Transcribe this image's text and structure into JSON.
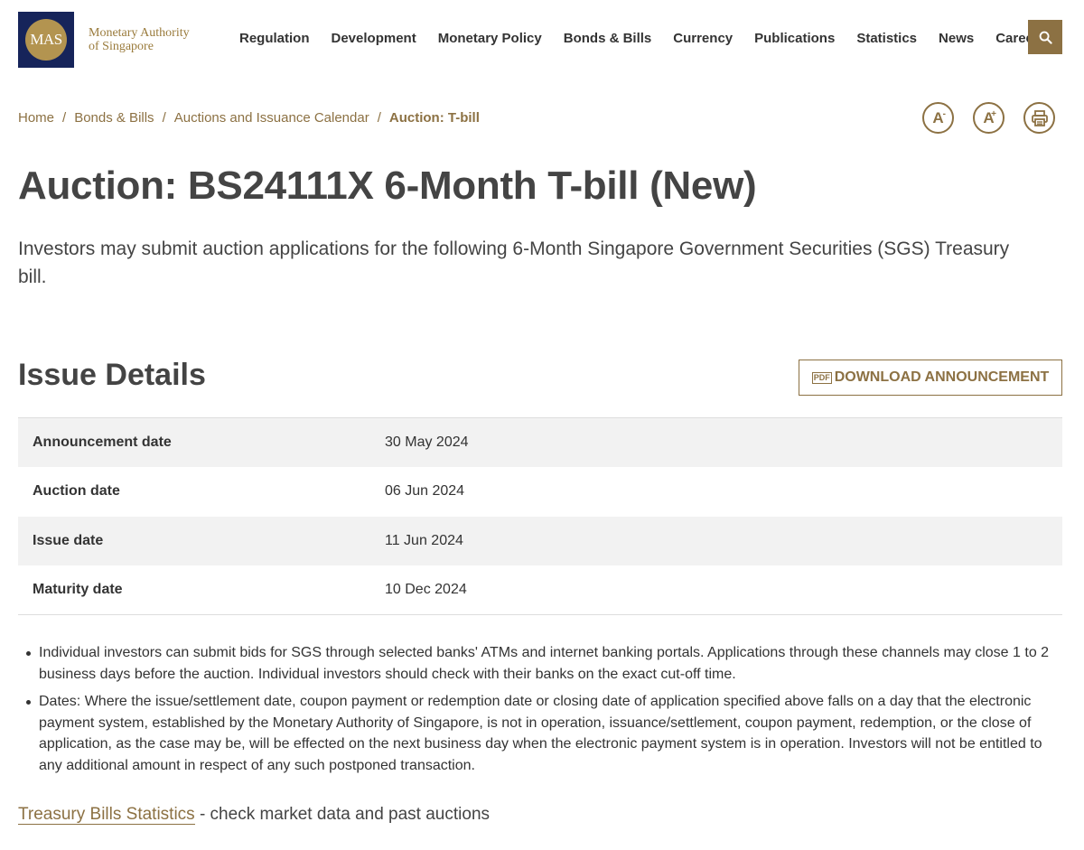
{
  "header": {
    "logo_abbr": "MAS",
    "logo_line1": "Monetary Authority",
    "logo_line2": "of Singapore",
    "nav": [
      {
        "label": "Regulation"
      },
      {
        "label": "Development"
      },
      {
        "label": "Monetary Policy"
      },
      {
        "label": "Bonds & Bills"
      },
      {
        "label": "Currency"
      },
      {
        "label": "Publications"
      },
      {
        "label": "Statistics"
      },
      {
        "label": "News"
      },
      {
        "label": "Careers"
      }
    ],
    "search_icon": "search-icon"
  },
  "breadcrumb": {
    "items": [
      {
        "label": "Home"
      },
      {
        "label": "Bonds & Bills"
      },
      {
        "label": "Auctions and Issuance Calendar"
      }
    ],
    "separator": "/",
    "current": "Auction: T-bill"
  },
  "tools": {
    "decrease_font": "A",
    "decrease_sup": "-",
    "increase_font": "A",
    "increase_sup": "+",
    "print_icon": "print-icon"
  },
  "page": {
    "title": "Auction: BS24111X 6-Month T-bill (New)",
    "intro": "Investors may submit auction applications for the following 6-Month Singapore Government Securities (SGS) Treasury bill."
  },
  "issue_details": {
    "title": "Issue Details",
    "download_icon_text": "PDF",
    "download_label": "DOWNLOAD ANNOUNCEMENT",
    "rows": [
      {
        "label": "Announcement date",
        "value": "30 May 2024"
      },
      {
        "label": "Auction date",
        "value": "06 Jun 2024"
      },
      {
        "label": "Issue date",
        "value": "11 Jun 2024"
      },
      {
        "label": "Maturity date",
        "value": "10 Dec 2024"
      }
    ]
  },
  "notes": [
    "Individual investors can submit bids for SGS through selected banks' ATMs and internet banking portals. Applications through these channels may close 1 to 2 business days before the auction. Individual investors should check with their banks on the exact cut-off time.",
    "Dates: Where the issue/settlement date, coupon payment or redemption date or closing date of application specified above falls on a day that the electronic payment system, established by the Monetary Authority of Singapore, is not in operation, issuance/settlement, coupon payment, redemption, or the close of application, as the case may be, will be effected on the next business day when the electronic payment system is in operation. Investors will not be entitled to any additional amount in respect of any such postponed transaction."
  ],
  "footer": {
    "link_label": "Treasury Bills Statistics",
    "link_suffix": " - check market data and past auctions"
  },
  "colors": {
    "accent": "#8c7143",
    "logo_navy": "#16245a",
    "logo_gold": "#b39450"
  }
}
